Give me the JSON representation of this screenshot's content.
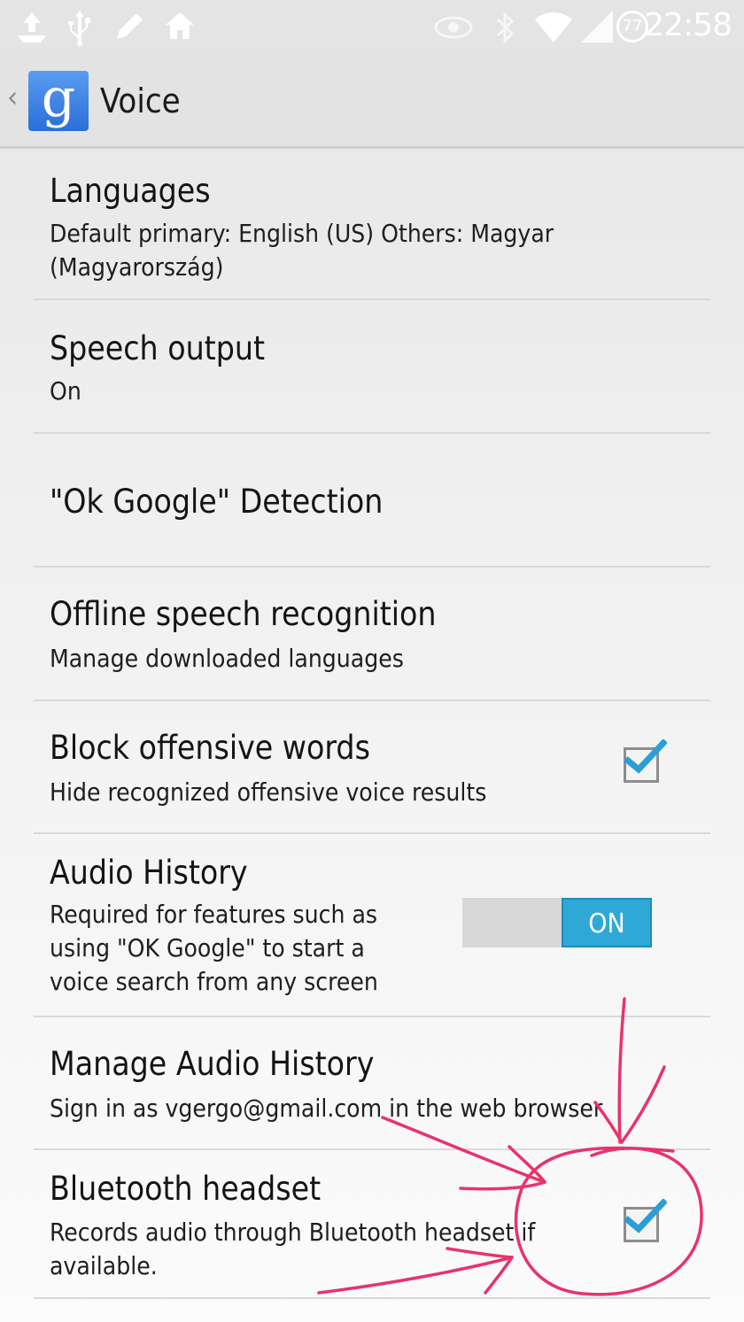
{
  "status_bar": {
    "time": "22:58",
    "battery_level": "77",
    "icons": [
      "upload-icon",
      "usb-icon",
      "pencil-icon",
      "home-icon",
      "eye-icon",
      "bluetooth-icon",
      "wifi-icon",
      "signal-icon",
      "battery-icon"
    ]
  },
  "action_bar": {
    "back": "‹",
    "logo_letter": "g",
    "title": "Voice"
  },
  "settings": [
    {
      "title": "Languages",
      "subtitle": "Default primary: English (US) Others: Magyar (Magyarország)"
    },
    {
      "title": "Speech output",
      "subtitle": "On"
    },
    {
      "title": "\"Ok Google\" Detection",
      "subtitle": ""
    },
    {
      "title": "Offline speech recognition",
      "subtitle": "Manage downloaded languages"
    },
    {
      "title": "Block offensive words",
      "subtitle": "Hide recognized offensive voice results",
      "checked": true
    },
    {
      "title": "Audio History",
      "subtitle": "Required for features such as using \"OK Google\" to start a voice search from any screen",
      "toggle": "ON"
    },
    {
      "title": "Manage Audio History",
      "subtitle": "Sign in as vgergo@gmail.com in the web browser"
    },
    {
      "title": "Bluetooth headset",
      "subtitle": "Records audio through Bluetooth headset if available.",
      "checked": true
    }
  ],
  "colors": {
    "accent": "#2fa8d8",
    "annotation": "#e8336a",
    "check": "#2a9fd6"
  }
}
